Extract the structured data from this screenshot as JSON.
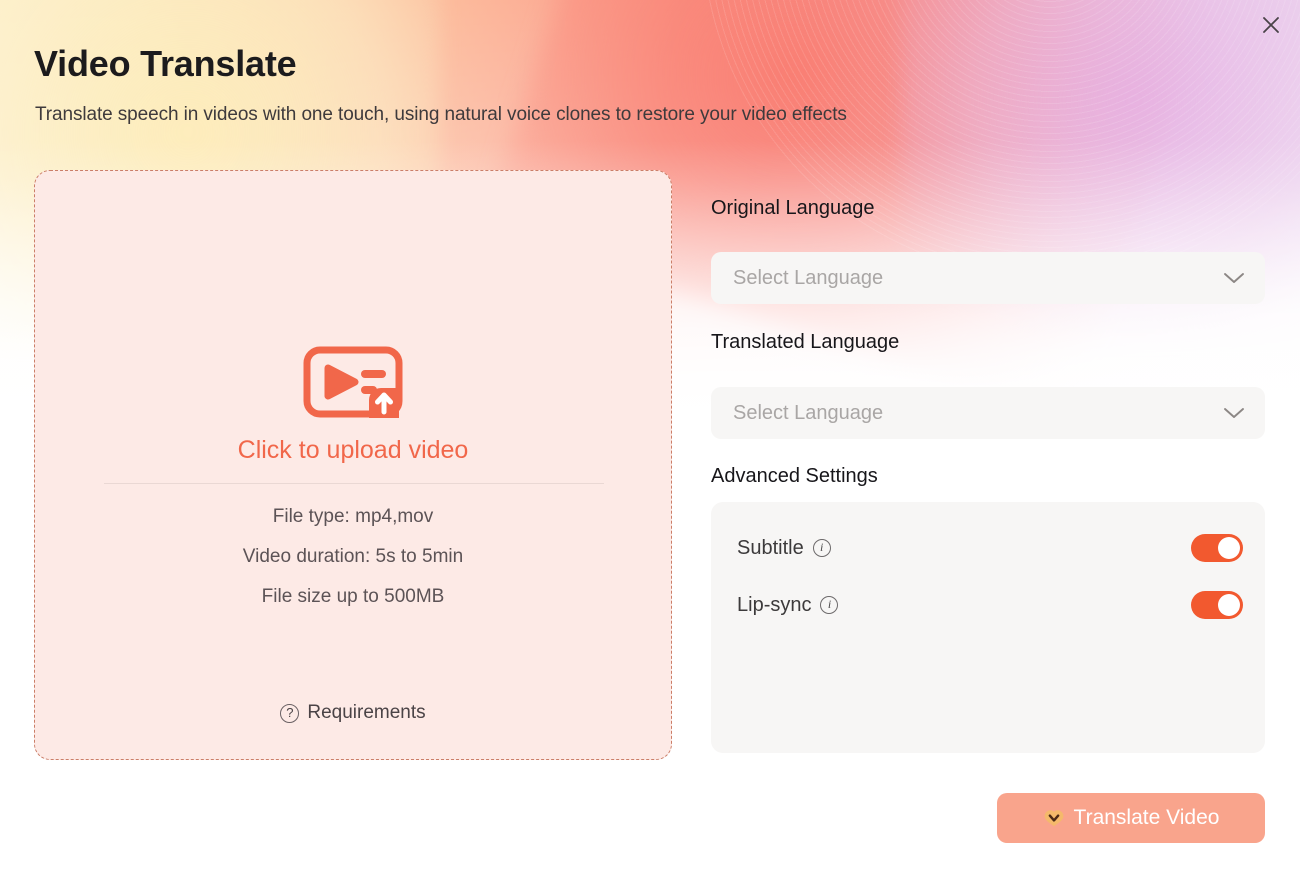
{
  "window": {
    "close_label": "✕"
  },
  "header": {
    "title": "Video Translate",
    "subtitle": "Translate speech in videos with one touch, using natural voice clones to restore your video effects"
  },
  "upload": {
    "icon": "video-upload-icon",
    "cta": "Click to upload video",
    "specs": [
      "File type: mp4,mov",
      "Video duration: 5s to 5min",
      "File size up to  500MB"
    ],
    "requirements_label": "Requirements",
    "requirements_icon": "question-circle-icon",
    "border_color": "#cb7e68",
    "background_color": "#fdeae6",
    "accent_color": "#f1674a"
  },
  "settings": {
    "original_language": {
      "label": "Original Language",
      "value": "",
      "placeholder": "Select Language",
      "chevron_icon": "chevron-down-icon"
    },
    "translated_language": {
      "label": "Translated Language",
      "value": "",
      "placeholder": "Select Language",
      "chevron_icon": "chevron-down-icon"
    },
    "advanced": {
      "label": "Advanced Settings",
      "rows": [
        {
          "label": "Subtitle",
          "info_icon": "info-circle-icon",
          "state": "on"
        },
        {
          "label": "Lip-sync",
          "info_icon": "info-circle-icon",
          "state": "on"
        }
      ],
      "toggle_on_color": "#f2592f"
    }
  },
  "actions": {
    "translate": {
      "label": "Translate Video",
      "badge_icon": "premium-gem-icon",
      "color": "#f9a48c"
    }
  }
}
